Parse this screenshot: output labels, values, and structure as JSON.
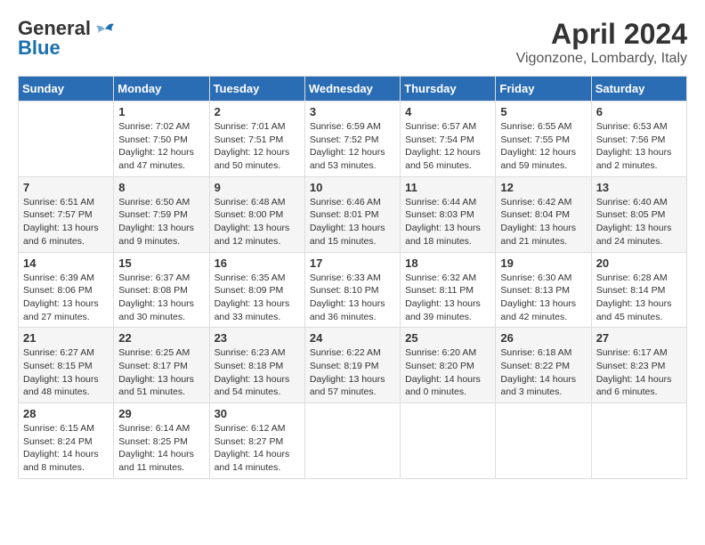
{
  "header": {
    "logo_line1": "General",
    "logo_line2": "Blue",
    "title": "April 2024",
    "subtitle": "Vigonzone, Lombardy, Italy"
  },
  "calendar": {
    "days_of_week": [
      "Sunday",
      "Monday",
      "Tuesday",
      "Wednesday",
      "Thursday",
      "Friday",
      "Saturday"
    ],
    "weeks": [
      [
        {
          "day": "",
          "info": ""
        },
        {
          "day": "1",
          "info": "Sunrise: 7:02 AM\nSunset: 7:50 PM\nDaylight: 12 hours\nand 47 minutes."
        },
        {
          "day": "2",
          "info": "Sunrise: 7:01 AM\nSunset: 7:51 PM\nDaylight: 12 hours\nand 50 minutes."
        },
        {
          "day": "3",
          "info": "Sunrise: 6:59 AM\nSunset: 7:52 PM\nDaylight: 12 hours\nand 53 minutes."
        },
        {
          "day": "4",
          "info": "Sunrise: 6:57 AM\nSunset: 7:54 PM\nDaylight: 12 hours\nand 56 minutes."
        },
        {
          "day": "5",
          "info": "Sunrise: 6:55 AM\nSunset: 7:55 PM\nDaylight: 12 hours\nand 59 minutes."
        },
        {
          "day": "6",
          "info": "Sunrise: 6:53 AM\nSunset: 7:56 PM\nDaylight: 13 hours\nand 2 minutes."
        }
      ],
      [
        {
          "day": "7",
          "info": "Sunrise: 6:51 AM\nSunset: 7:57 PM\nDaylight: 13 hours\nand 6 minutes."
        },
        {
          "day": "8",
          "info": "Sunrise: 6:50 AM\nSunset: 7:59 PM\nDaylight: 13 hours\nand 9 minutes."
        },
        {
          "day": "9",
          "info": "Sunrise: 6:48 AM\nSunset: 8:00 PM\nDaylight: 13 hours\nand 12 minutes."
        },
        {
          "day": "10",
          "info": "Sunrise: 6:46 AM\nSunset: 8:01 PM\nDaylight: 13 hours\nand 15 minutes."
        },
        {
          "day": "11",
          "info": "Sunrise: 6:44 AM\nSunset: 8:03 PM\nDaylight: 13 hours\nand 18 minutes."
        },
        {
          "day": "12",
          "info": "Sunrise: 6:42 AM\nSunset: 8:04 PM\nDaylight: 13 hours\nand 21 minutes."
        },
        {
          "day": "13",
          "info": "Sunrise: 6:40 AM\nSunset: 8:05 PM\nDaylight: 13 hours\nand 24 minutes."
        }
      ],
      [
        {
          "day": "14",
          "info": "Sunrise: 6:39 AM\nSunset: 8:06 PM\nDaylight: 13 hours\nand 27 minutes."
        },
        {
          "day": "15",
          "info": "Sunrise: 6:37 AM\nSunset: 8:08 PM\nDaylight: 13 hours\nand 30 minutes."
        },
        {
          "day": "16",
          "info": "Sunrise: 6:35 AM\nSunset: 8:09 PM\nDaylight: 13 hours\nand 33 minutes."
        },
        {
          "day": "17",
          "info": "Sunrise: 6:33 AM\nSunset: 8:10 PM\nDaylight: 13 hours\nand 36 minutes."
        },
        {
          "day": "18",
          "info": "Sunrise: 6:32 AM\nSunset: 8:11 PM\nDaylight: 13 hours\nand 39 minutes."
        },
        {
          "day": "19",
          "info": "Sunrise: 6:30 AM\nSunset: 8:13 PM\nDaylight: 13 hours\nand 42 minutes."
        },
        {
          "day": "20",
          "info": "Sunrise: 6:28 AM\nSunset: 8:14 PM\nDaylight: 13 hours\nand 45 minutes."
        }
      ],
      [
        {
          "day": "21",
          "info": "Sunrise: 6:27 AM\nSunset: 8:15 PM\nDaylight: 13 hours\nand 48 minutes."
        },
        {
          "day": "22",
          "info": "Sunrise: 6:25 AM\nSunset: 8:17 PM\nDaylight: 13 hours\nand 51 minutes."
        },
        {
          "day": "23",
          "info": "Sunrise: 6:23 AM\nSunset: 8:18 PM\nDaylight: 13 hours\nand 54 minutes."
        },
        {
          "day": "24",
          "info": "Sunrise: 6:22 AM\nSunset: 8:19 PM\nDaylight: 13 hours\nand 57 minutes."
        },
        {
          "day": "25",
          "info": "Sunrise: 6:20 AM\nSunset: 8:20 PM\nDaylight: 14 hours\nand 0 minutes."
        },
        {
          "day": "26",
          "info": "Sunrise: 6:18 AM\nSunset: 8:22 PM\nDaylight: 14 hours\nand 3 minutes."
        },
        {
          "day": "27",
          "info": "Sunrise: 6:17 AM\nSunset: 8:23 PM\nDaylight: 14 hours\nand 6 minutes."
        }
      ],
      [
        {
          "day": "28",
          "info": "Sunrise: 6:15 AM\nSunset: 8:24 PM\nDaylight: 14 hours\nand 8 minutes."
        },
        {
          "day": "29",
          "info": "Sunrise: 6:14 AM\nSunset: 8:25 PM\nDaylight: 14 hours\nand 11 minutes."
        },
        {
          "day": "30",
          "info": "Sunrise: 6:12 AM\nSunset: 8:27 PM\nDaylight: 14 hours\nand 14 minutes."
        },
        {
          "day": "",
          "info": ""
        },
        {
          "day": "",
          "info": ""
        },
        {
          "day": "",
          "info": ""
        },
        {
          "day": "",
          "info": ""
        }
      ]
    ]
  }
}
